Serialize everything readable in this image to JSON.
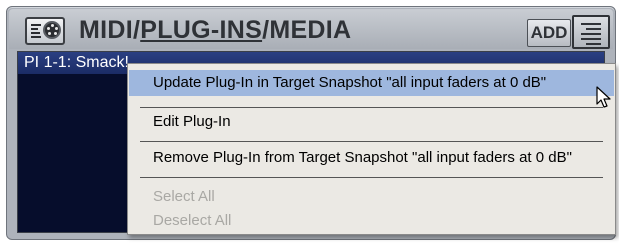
{
  "panel": {
    "title_part1": "MIDI/",
    "title_part2": "PLUG-INS",
    "title_part3": "/MEDIA",
    "add_label": "ADD",
    "midi_icon": "midi-din-icon",
    "list_icon": "list-menu-icon"
  },
  "slot": {
    "label": "PI 1-1: Smack!"
  },
  "context_menu": {
    "update_label": "Update Plug-In in Target Snapshot \"all input faders at 0 dB\"",
    "edit_label": "Edit Plug-In",
    "remove_label": "Remove Plug-In from Target Snapshot \"all input faders at 0 dB\"",
    "select_all_label": "Select All",
    "deselect_all_label": "Deselect All"
  },
  "colors": {
    "highlight": "#9eb7de",
    "slot_bg": "#1b2c66",
    "list_bg": "#060d2c",
    "menu_bg": "#ebe9e4"
  }
}
